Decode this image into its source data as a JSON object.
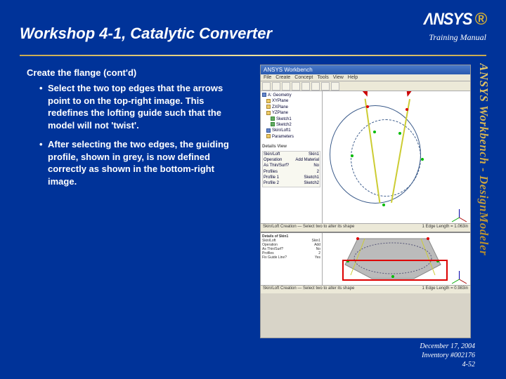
{
  "header": {
    "title": "Workshop 4-1, Catalytic Converter",
    "logo": "ΛNSYS",
    "training": "Training Manual"
  },
  "body": {
    "section_title": "Create the flange (cont'd)",
    "bullets": [
      "Select the two top edges that the arrows point to on the top-right image.  This redefines the lofting guide such that the model will not 'twist'.",
      "After selecting the two edges, the guiding profile, shown in grey, is now defined correctly as shown in the bottom-right image."
    ]
  },
  "side_label": "ANSYS Workbench - DesignModeler",
  "app": {
    "title": "ANSYS Workbench",
    "menu": [
      "File",
      "Create",
      "Concept",
      "Tools",
      "View",
      "Help"
    ],
    "tree": {
      "root": "A: Geometry",
      "nodes": [
        "XYPlane",
        "ZXPlane",
        "YZPlane",
        "Sketch1",
        "Sketch2",
        "Skin/Loft1",
        "Parameters"
      ]
    },
    "details_title": "Details View",
    "details_rows": [
      [
        "Skin/Loft",
        "Skin1"
      ],
      [
        "Operation",
        "Add Material"
      ],
      [
        "As Thin/Surf?",
        "No"
      ],
      [
        "Profiles",
        "2"
      ],
      [
        "Profile 1",
        "Sketch1"
      ],
      [
        "Profile 2",
        "Sketch2"
      ]
    ],
    "status_left": "Skin/Loft Creation — Select two to alter its shape",
    "status_right": "1 Edge Length = 1.063in",
    "lower_status_left": "Skin/Loft Creation — Select two to alter its shape",
    "lower_status_right": "1 Edge Length = 0.983in",
    "lower_details_title": "Details of Skin1",
    "lower_rows": [
      [
        "Skin/Loft",
        "Skin1"
      ],
      [
        "Operation",
        "Add"
      ],
      [
        "As Thin/Surf?",
        "No"
      ],
      [
        "Profiles",
        "2"
      ],
      [
        "Fix Guide Line?",
        "Yes"
      ]
    ]
  },
  "footer": {
    "date": "December 17, 2004",
    "inventory": "Inventory #002176",
    "page": "4-52"
  }
}
